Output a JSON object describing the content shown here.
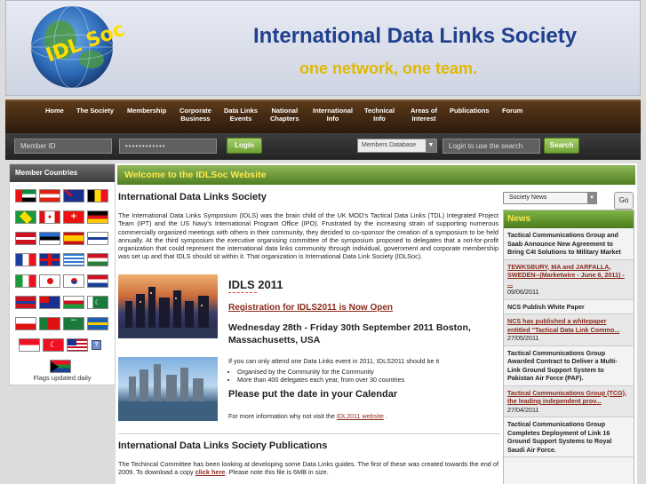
{
  "header": {
    "logo_text": "IDL Soc",
    "title": "International Data Links Society",
    "tagline": "one network, one team."
  },
  "nav": [
    {
      "label": "Home"
    },
    {
      "label": "The Society"
    },
    {
      "label": "Membership"
    },
    {
      "label": "Corporate\nBusiness"
    },
    {
      "label": "Data Links\nEvents"
    },
    {
      "label": "National\nChapters"
    },
    {
      "label": "International\nInfo"
    },
    {
      "label": "Technical\nInfo"
    },
    {
      "label": "Areas of\nInterest"
    },
    {
      "label": "Publications"
    },
    {
      "label": "Forum"
    }
  ],
  "login": {
    "member_id_placeholder": "Member ID",
    "password_mask": "••••••••••••",
    "login_label": "Login",
    "database_label": "Members Database",
    "search_placeholder": "Login to use the search",
    "search_label": "Search"
  },
  "sidebar": {
    "heading": "Member Countries",
    "flags_caption": "Flags updated daily"
  },
  "main": {
    "welcome": "Welcome to the IDLSoc Website",
    "intro_heading": "International Data Links Society",
    "intro_text": "The International Data Links Symposium (IDLS) was the brain child of the UK MOD's Tactical Data Links (TDL) Integrated Project Team (IPT) and the US Navy's International Program Office (IPO). Frustrated by the increasing strain of supporting numerous commercially organized meetings with others in their community, they decided to co-sponsor the creation of a symposium to be held annually. At the third symposium the executive organising committee of the symposium proposed to delegates that a not-for-profit organization that could represent the international data links community through individual, government and corporate membership was set up and that IDLS should sit within it. That organization is International Data Link Society (IDLSoc).",
    "event_title": "IDLS 2011",
    "event_reg": "Registration for IDLS2011 is Now Open",
    "event_dates": "Wednesday 28th - Friday 30th September 2011 Boston, Massachusetts, USA",
    "event_note": "If you can only attend one Data Links event in 2011, IDLS2011 should be it",
    "event_bullets": [
      "Organised by the Community for the Community",
      "More than 400 delegates each year, from over 30 countries"
    ],
    "event_calendar": "Please put the date in your Calendar",
    "event_more": "For more information why not visit the",
    "event_link": "IDL2011 website",
    "pub_heading": "International Data Links Society Publications",
    "pub_text": "The Techincal Committee has been looking at developing some Data Links guides. The first of these was created towards the end of 2009. To download a copy",
    "pub_link": "click here",
    "pub_tail": ". Please note this file is 6MB in size."
  },
  "news": {
    "select_value": "Society News",
    "go_label": "Go",
    "heading": "News",
    "items": [
      {
        "title": "Tactical Communications Group and Saab Announce New Agreement to Bring C4I Solutions to Military Market",
        "linked": false,
        "date": ""
      },
      {
        "title": "TEWKSBURY, MA and JARFALLA, SWEDEN--(Marketwire - June 6, 2011) - ...",
        "linked": true,
        "date": "09/06/2011"
      },
      {
        "title": "NCS Publish White Paper",
        "linked": false,
        "date": ""
      },
      {
        "title": "NCS has published a whitepaper entitled \"Tactical Data Link Commo...",
        "linked": true,
        "date": "27/05/2011"
      },
      {
        "title": "Tactical Communications Group Awarded Contract to Deliver a Multi-Link Ground Support System to Pakistan Air Force (PAF).",
        "linked": false,
        "date": ""
      },
      {
        "title": "Tactical Communications Group (TCG), the leading independent prov...",
        "linked": true,
        "date": "27/04/2011"
      },
      {
        "title": "Tactical Communications Group Completes Deployment of Link 16 Ground Support Systems to Royal Saudi Air Force.",
        "linked": false,
        "date": ""
      }
    ]
  }
}
